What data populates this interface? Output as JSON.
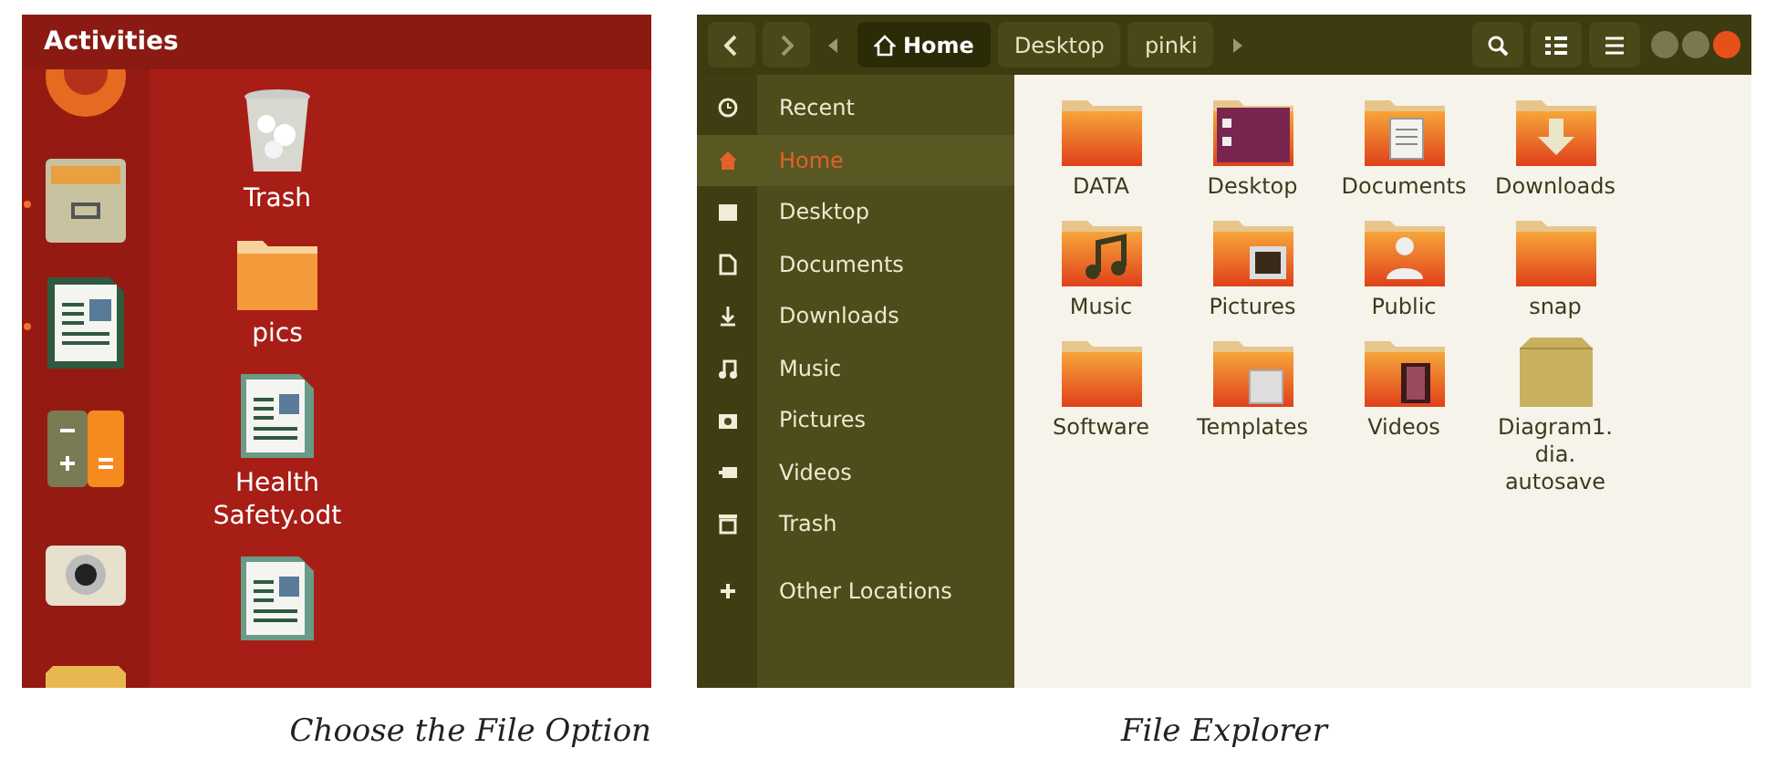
{
  "desktop": {
    "top_bar": {
      "title": "Activities"
    },
    "dock": [
      {
        "kind": "browser",
        "running": false
      },
      {
        "kind": "files",
        "running": true
      },
      {
        "kind": "writer",
        "running": true
      },
      {
        "kind": "calculator",
        "running": false
      },
      {
        "kind": "camera",
        "running": false
      },
      {
        "kind": "folder",
        "running": false
      }
    ],
    "icons": [
      {
        "kind": "trash",
        "label": "Trash"
      },
      {
        "kind": "folder",
        "label": "pics"
      },
      {
        "kind": "document",
        "label": "Health\nSafety.odt"
      },
      {
        "kind": "document"
      }
    ],
    "caption": "Choose the File Option"
  },
  "file_explorer": {
    "path": [
      {
        "label": "Home",
        "kind": "home",
        "selected": true
      },
      {
        "label": "Desktop",
        "kind": "folder",
        "selected": false
      },
      {
        "label": "pinki",
        "kind": "folder",
        "selected": false
      }
    ],
    "sidebar": [
      {
        "kind": "recent",
        "label": "Recent",
        "selected": false
      },
      {
        "kind": "home",
        "label": "Home",
        "selected": true
      },
      {
        "kind": "desktop",
        "label": "Desktop",
        "selected": false
      },
      {
        "kind": "documents",
        "label": "Documents",
        "selected": false
      },
      {
        "kind": "downloads",
        "label": "Downloads",
        "selected": false
      },
      {
        "kind": "music",
        "label": "Music",
        "selected": false
      },
      {
        "kind": "pictures",
        "label": "Pictures",
        "selected": false
      },
      {
        "kind": "videos",
        "label": "Videos",
        "selected": false
      },
      {
        "kind": "trash",
        "label": "Trash",
        "selected": false
      },
      {
        "kind": "other",
        "label": "Other Locations",
        "selected": false
      }
    ],
    "files": [
      {
        "kind": "folder",
        "label": "DATA"
      },
      {
        "kind": "desktop",
        "label": "Desktop"
      },
      {
        "kind": "documents",
        "label": "Documents"
      },
      {
        "kind": "downloads",
        "label": "Downloads"
      },
      {
        "kind": "music",
        "label": "Music"
      },
      {
        "kind": "pictures",
        "label": "Pictures"
      },
      {
        "kind": "public",
        "label": "Public"
      },
      {
        "kind": "folder",
        "label": "snap"
      },
      {
        "kind": "folder",
        "label": "Software"
      },
      {
        "kind": "templates",
        "label": "Templates"
      },
      {
        "kind": "videos",
        "label": "Videos"
      },
      {
        "kind": "archive",
        "label": "Diagram1.\ndia.\nautosave"
      }
    ],
    "caption": "File Explorer"
  }
}
